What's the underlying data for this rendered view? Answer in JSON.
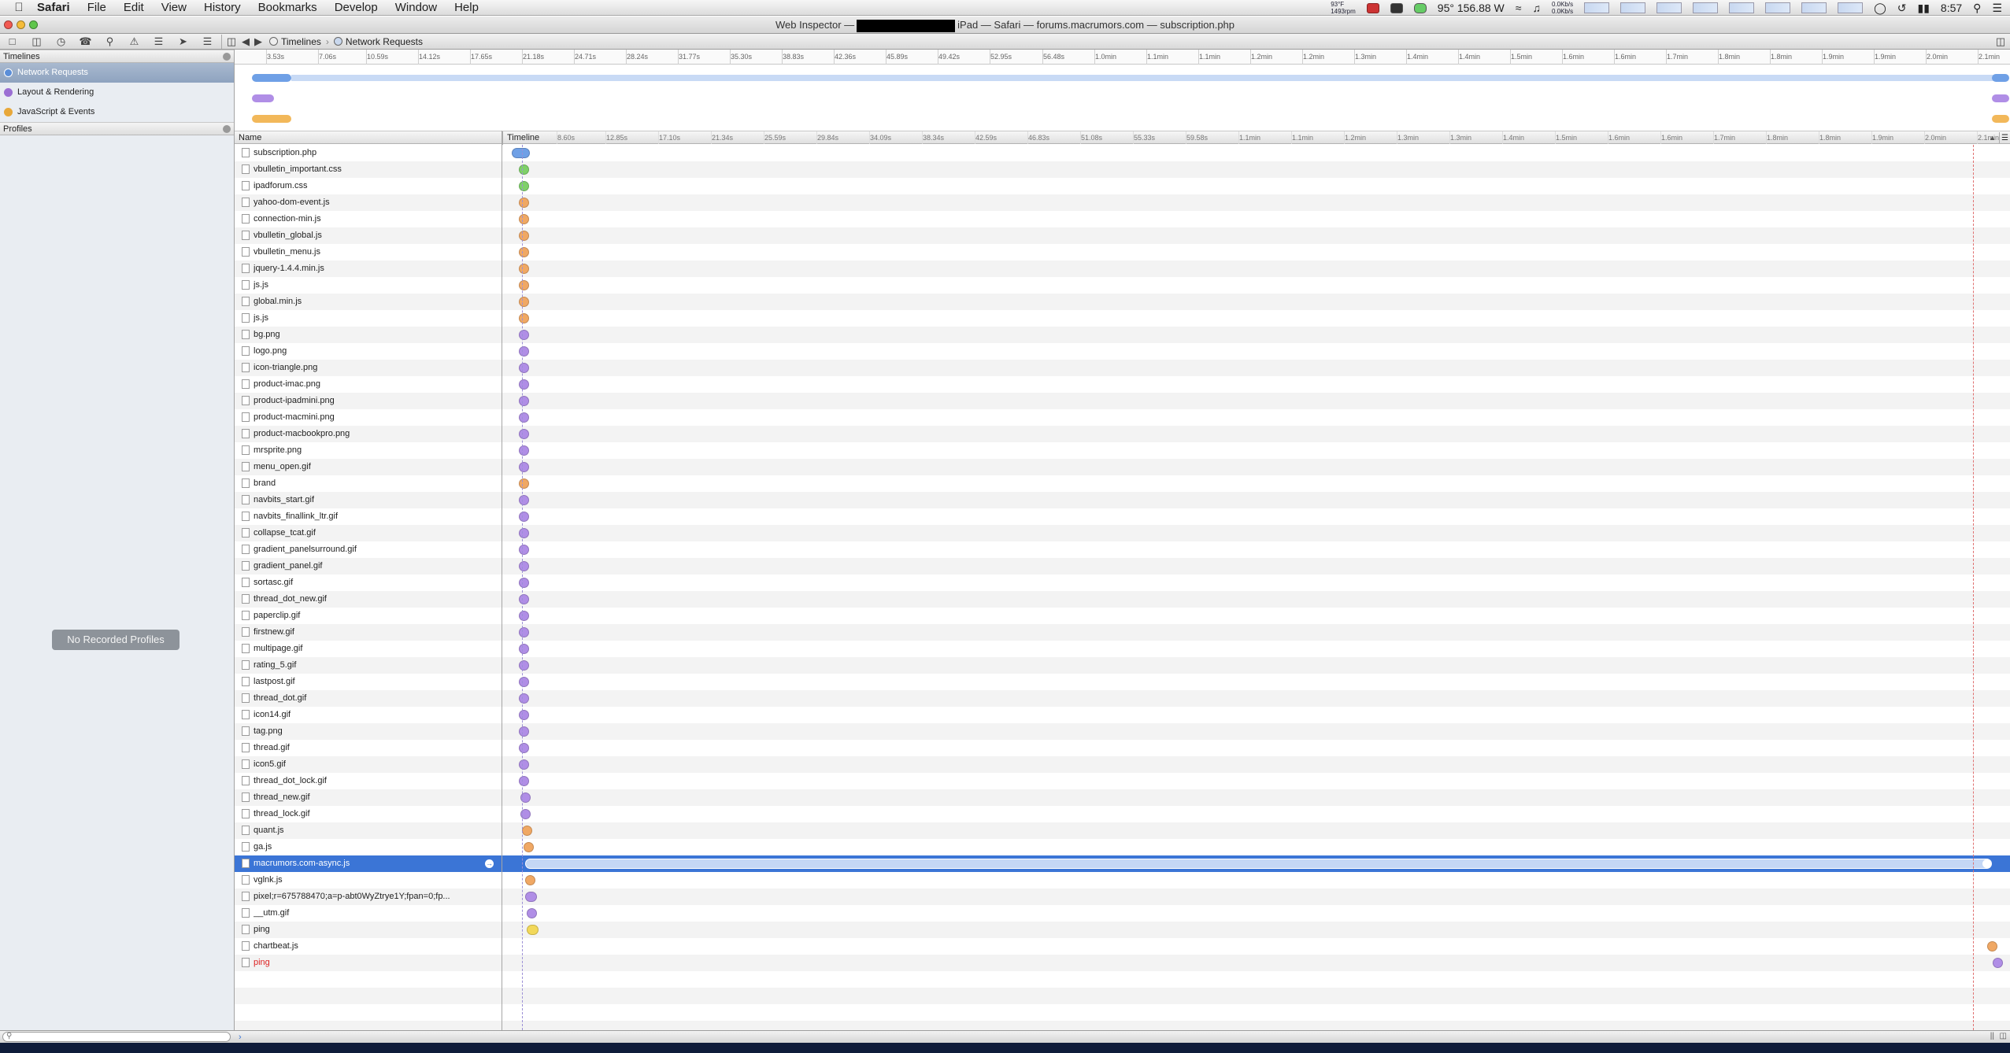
{
  "menubar": {
    "app": "Safari",
    "items": [
      "File",
      "Edit",
      "View",
      "History",
      "Bookmarks",
      "Develop",
      "Window",
      "Help"
    ],
    "temp_small": "93°F",
    "rpm": "1493rpm",
    "cpu_temp": "95° 156.88 W",
    "net_up": "0.0Kb/s",
    "net_down": "0.0Kb/s",
    "clock": "8:57"
  },
  "window": {
    "title_left": "Web Inspector —",
    "title_right": "iPad — Safari — forums.macrumors.com — subscription.php"
  },
  "toolbar": {
    "crumb1": "Timelines",
    "crumb2": "Network Requests"
  },
  "sidebar": {
    "timelines_header": "Timelines",
    "items": [
      {
        "label": "Network Requests",
        "color": "#5b8ed8"
      },
      {
        "label": "Layout & Rendering",
        "color": "#9b6fd3"
      },
      {
        "label": "JavaScript & Events",
        "color": "#e8a83a"
      }
    ],
    "profiles_header": "Profiles",
    "no_profiles": "No Recorded Profiles"
  },
  "overview": {
    "ticks": [
      "3.53s",
      "7.06s",
      "10.59s",
      "14.12s",
      "17.65s",
      "21.18s",
      "24.71s",
      "28.24s",
      "31.77s",
      "35.30s",
      "38.83s",
      "42.36s",
      "45.89s",
      "49.42s",
      "52.95s",
      "56.48s",
      "1.0min",
      "1.1min",
      "1.1min",
      "1.2min",
      "1.2min",
      "1.3min",
      "1.4min",
      "1.4min",
      "1.5min",
      "1.6min",
      "1.6min",
      "1.7min",
      "1.8min",
      "1.8min",
      "1.9min",
      "1.9min",
      "2.0min",
      "2.1min"
    ]
  },
  "columns": {
    "name": "Name",
    "timeline": "Timeline",
    "ticks": [
      "8.60s",
      "12.85s",
      "17.10s",
      "21.34s",
      "25.59s",
      "29.84s",
      "34.09s",
      "38.34s",
      "42.59s",
      "46.83s",
      "51.08s",
      "55.33s",
      "59.58s",
      "1.1min",
      "1.1min",
      "1.2min",
      "1.3min",
      "1.3min",
      "1.4min",
      "1.5min",
      "1.6min",
      "1.6min",
      "1.7min",
      "1.8min",
      "1.8min",
      "1.9min",
      "2.0min",
      "2.1min"
    ]
  },
  "colors": {
    "document": "#6fa0e6",
    "stylesheet": "#7fd06a",
    "script": "#f0a864",
    "image": "#b08ee6",
    "other": "#f2d85a",
    "selection": "#3b75d6"
  },
  "requests": [
    {
      "name": "subscription.php",
      "kind": "document",
      "start": 0.003,
      "end": 0.015
    },
    {
      "name": "vbulletin_important.css",
      "kind": "stylesheet",
      "start": 0.008,
      "end": 0.013
    },
    {
      "name": "ipadforum.css",
      "kind": "stylesheet",
      "start": 0.008,
      "end": 0.013
    },
    {
      "name": "yahoo-dom-event.js",
      "kind": "script",
      "start": 0.008,
      "end": 0.013
    },
    {
      "name": "connection-min.js",
      "kind": "script",
      "start": 0.008,
      "end": 0.013
    },
    {
      "name": "vbulletin_global.js",
      "kind": "script",
      "start": 0.008,
      "end": 0.013
    },
    {
      "name": "vbulletin_menu.js",
      "kind": "script",
      "start": 0.008,
      "end": 0.013
    },
    {
      "name": "jquery-1.4.4.min.js",
      "kind": "script",
      "start": 0.008,
      "end": 0.013
    },
    {
      "name": "js.js",
      "kind": "script",
      "start": 0.008,
      "end": 0.013
    },
    {
      "name": "global.min.js",
      "kind": "script",
      "start": 0.008,
      "end": 0.013
    },
    {
      "name": "js.js",
      "kind": "script",
      "start": 0.008,
      "end": 0.013
    },
    {
      "name": "bg.png",
      "kind": "image",
      "start": 0.008,
      "end": 0.014
    },
    {
      "name": "logo.png",
      "kind": "image",
      "start": 0.008,
      "end": 0.014
    },
    {
      "name": "icon-triangle.png",
      "kind": "image",
      "start": 0.008,
      "end": 0.014
    },
    {
      "name": "product-imac.png",
      "kind": "image",
      "start": 0.008,
      "end": 0.014
    },
    {
      "name": "product-ipadmini.png",
      "kind": "image",
      "start": 0.008,
      "end": 0.014
    },
    {
      "name": "product-macmini.png",
      "kind": "image",
      "start": 0.008,
      "end": 0.014
    },
    {
      "name": "product-macbookpro.png",
      "kind": "image",
      "start": 0.008,
      "end": 0.014
    },
    {
      "name": "mrsprite.png",
      "kind": "image",
      "start": 0.008,
      "end": 0.014
    },
    {
      "name": "menu_open.gif",
      "kind": "image",
      "start": 0.008,
      "end": 0.014
    },
    {
      "name": "brand",
      "kind": "script",
      "start": 0.008,
      "end": 0.014
    },
    {
      "name": "navbits_start.gif",
      "kind": "image",
      "start": 0.008,
      "end": 0.014
    },
    {
      "name": "navbits_finallink_ltr.gif",
      "kind": "image",
      "start": 0.008,
      "end": 0.014
    },
    {
      "name": "collapse_tcat.gif",
      "kind": "image",
      "start": 0.008,
      "end": 0.014
    },
    {
      "name": "gradient_panelsurround.gif",
      "kind": "image",
      "start": 0.008,
      "end": 0.014
    },
    {
      "name": "gradient_panel.gif",
      "kind": "image",
      "start": 0.008,
      "end": 0.014
    },
    {
      "name": "sortasc.gif",
      "kind": "image",
      "start": 0.008,
      "end": 0.014
    },
    {
      "name": "thread_dot_new.gif",
      "kind": "image",
      "start": 0.008,
      "end": 0.014
    },
    {
      "name": "paperclip.gif",
      "kind": "image",
      "start": 0.008,
      "end": 0.014
    },
    {
      "name": "firstnew.gif",
      "kind": "image",
      "start": 0.008,
      "end": 0.014
    },
    {
      "name": "multipage.gif",
      "kind": "image",
      "start": 0.008,
      "end": 0.014
    },
    {
      "name": "rating_5.gif",
      "kind": "image",
      "start": 0.008,
      "end": 0.014
    },
    {
      "name": "lastpost.gif",
      "kind": "image",
      "start": 0.008,
      "end": 0.014
    },
    {
      "name": "thread_dot.gif",
      "kind": "image",
      "start": 0.008,
      "end": 0.014
    },
    {
      "name": "icon14.gif",
      "kind": "image",
      "start": 0.008,
      "end": 0.014
    },
    {
      "name": "tag.png",
      "kind": "image",
      "start": 0.008,
      "end": 0.014
    },
    {
      "name": "thread.gif",
      "kind": "image",
      "start": 0.008,
      "end": 0.014
    },
    {
      "name": "icon5.gif",
      "kind": "image",
      "start": 0.008,
      "end": 0.014
    },
    {
      "name": "thread_dot_lock.gif",
      "kind": "image",
      "start": 0.008,
      "end": 0.015
    },
    {
      "name": "thread_new.gif",
      "kind": "image",
      "start": 0.009,
      "end": 0.015
    },
    {
      "name": "thread_lock.gif",
      "kind": "image",
      "start": 0.009,
      "end": 0.015
    },
    {
      "name": "quant.js",
      "kind": "script",
      "start": 0.01,
      "end": 0.016
    },
    {
      "name": "ga.js",
      "kind": "script",
      "start": 0.011,
      "end": 0.017
    },
    {
      "name": "macrumors.com-async.js",
      "kind": "selected",
      "start": 0.012,
      "end": 0.995
    },
    {
      "name": "vglnk.js",
      "kind": "script",
      "start": 0.012,
      "end": 0.018
    },
    {
      "name": "pixel;r=675788470;a=p-abt0WyZtrye1Y;fpan=0;fp...",
      "kind": "image",
      "start": 0.012,
      "end": 0.02
    },
    {
      "name": "__utm.gif",
      "kind": "image",
      "start": 0.013,
      "end": 0.02
    },
    {
      "name": "ping",
      "kind": "other",
      "start": 0.013,
      "end": 0.021
    },
    {
      "name": "chartbeat.js",
      "kind": "script",
      "start": 0.992,
      "end": 0.998
    },
    {
      "name": "ping",
      "kind": "image",
      "start": 0.996,
      "end": 1.0,
      "red": true
    }
  ]
}
